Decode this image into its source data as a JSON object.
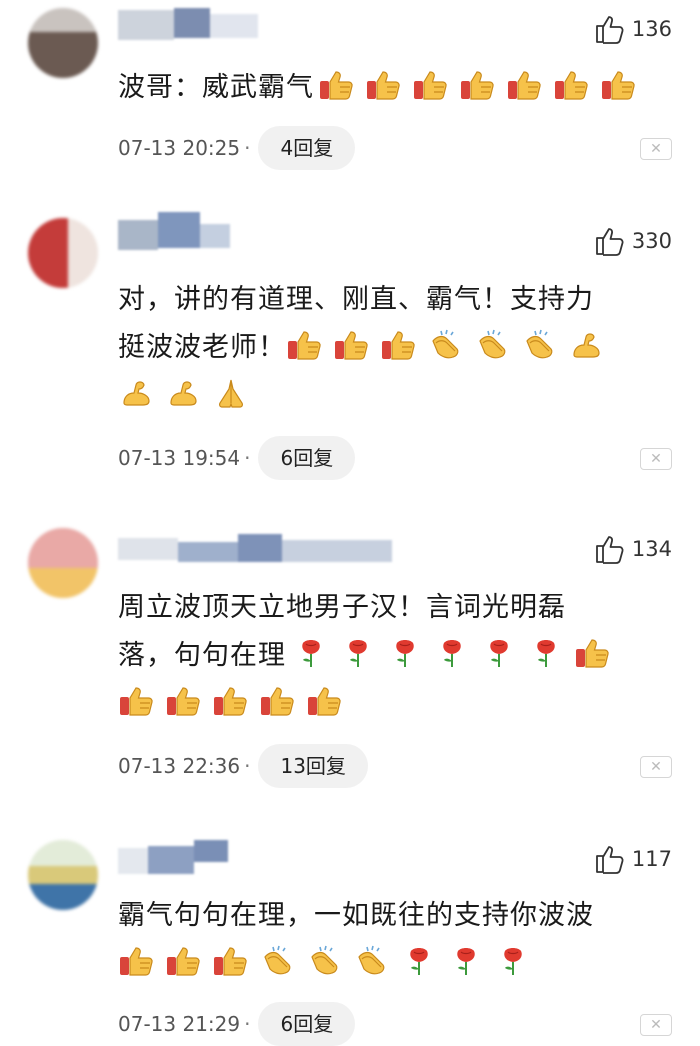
{
  "comments": [
    {
      "likes": "136",
      "lines": [
        "波哥：威武霸气"
      ],
      "emoji_rows": [
        [
          "thumb",
          "thumb",
          "thumb",
          "thumb",
          "thumb",
          "thumb",
          "thumb"
        ]
      ],
      "time": "07-13 20:25",
      "reply": "4回复"
    },
    {
      "likes": "330",
      "lines": [
        "对，讲的有道理、刚直、霸气！支持力",
        "挺波波老师！"
      ],
      "emoji_rows": [
        [
          "thumb",
          "thumb",
          "thumb",
          "clap",
          "clap",
          "clap",
          "muscle"
        ],
        [
          "muscle",
          "muscle",
          "pray"
        ]
      ],
      "time": "07-13 19:54",
      "reply": "6回复"
    },
    {
      "likes": "134",
      "lines": [
        "周立波顶天立地男子汉！言词光明磊",
        "落，句句在理"
      ],
      "emoji_rows": [
        [
          "rose",
          "rose",
          "rose",
          "rose",
          "rose",
          "rose",
          "thumb"
        ],
        [
          "thumb",
          "thumb",
          "thumb",
          "thumb",
          "thumb"
        ]
      ],
      "time": "07-13 22:36",
      "reply": "13回复"
    },
    {
      "likes": "117",
      "lines": [
        "霸气句句在理，一如既往的支持你波波"
      ],
      "emoji_rows": [
        [
          "thumb",
          "thumb",
          "thumb",
          "clap",
          "clap",
          "clap",
          "rose",
          "rose",
          "rose"
        ]
      ],
      "time": "07-13 21:29",
      "reply": "6回复"
    }
  ],
  "ui": {
    "dot": "·",
    "close_glyph": "✕"
  },
  "icons": {
    "like": "thumb-outline-icon",
    "close": "close-icon"
  },
  "colors": {
    "text": "#1a1a1a",
    "meta": "#555555",
    "reply_bg": "#f1f1f1",
    "thumb": "#f5b335",
    "rose": "#e03a2f"
  }
}
